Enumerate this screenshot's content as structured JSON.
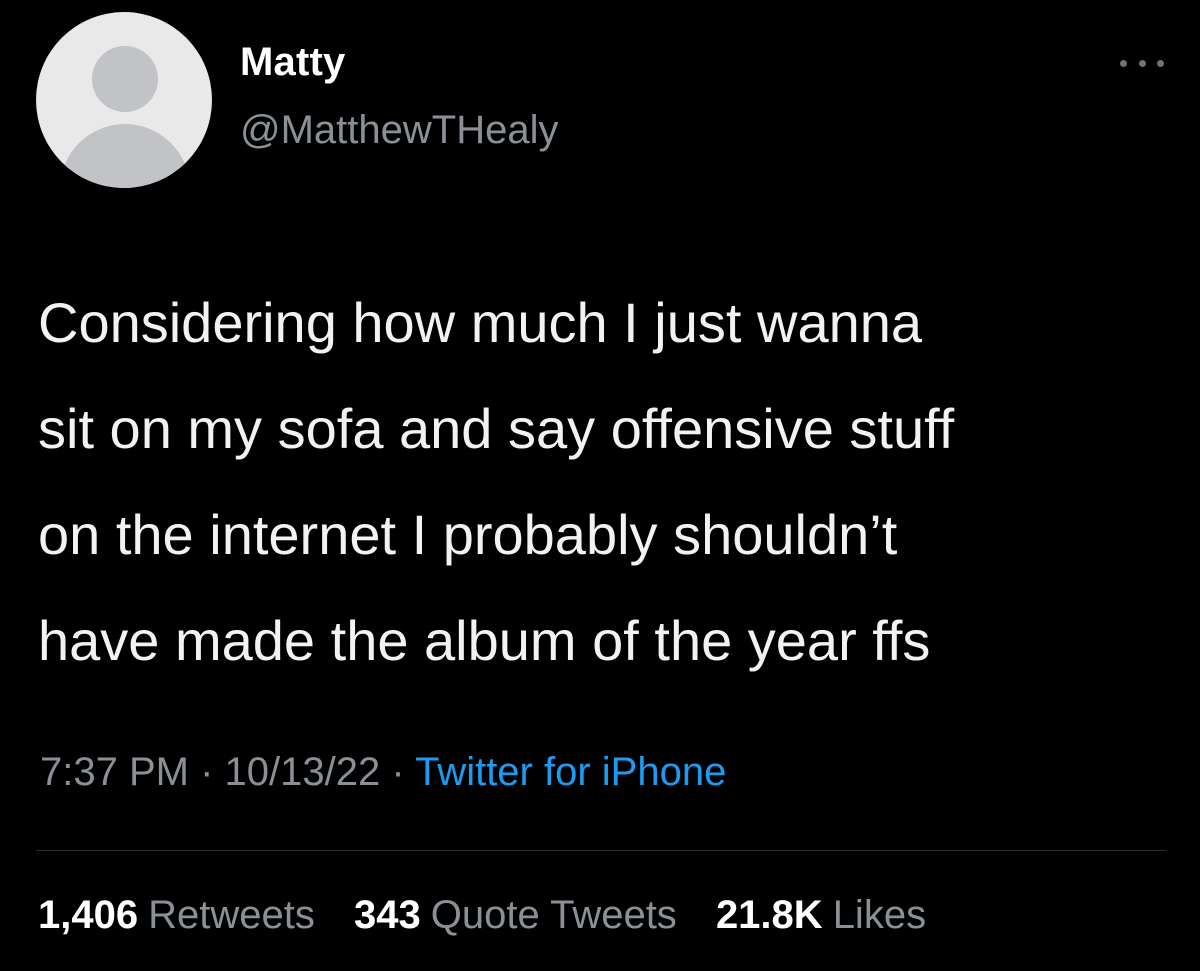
{
  "user": {
    "display_name": "Matty",
    "handle": "@MatthewTHealy",
    "avatar_icon": "default-avatar-icon"
  },
  "more_icon": "more-horizontal-icon",
  "tweet": {
    "text_lines": [
      "Considering how much I just wanna",
      "sit on my sofa and say offensive stuff",
      "on the internet I probably shouldn’t",
      "have made the album of the year ffs"
    ],
    "time": "7:37 PM",
    "separator": "·",
    "date": "10/13/22",
    "source": "Twitter for iPhone"
  },
  "stats": {
    "retweets": {
      "count": "1,406",
      "label": "Retweets"
    },
    "quote_tweets": {
      "count": "343",
      "label": "Quote Tweets"
    },
    "likes": {
      "count": "21.8K",
      "label": "Likes"
    }
  },
  "colors": {
    "background": "#000000",
    "text_primary": "#ffffff",
    "text_secondary": "#8b9096",
    "link": "#1d9bf0",
    "divider": "#2a2d31"
  }
}
